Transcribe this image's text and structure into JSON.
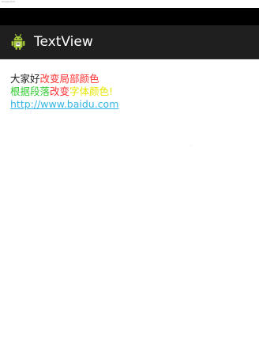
{
  "screenshot_label": "Screenshot",
  "action_bar": {
    "title": "TextView",
    "icon": "android-app-icon"
  },
  "colors": {
    "status_bar": "#000000",
    "action_bar": "#1f1f1f",
    "background": "#ffffff",
    "text_default": "#222222",
    "red": "#ff3333",
    "green": "#33cc33",
    "yellow": "#e6e600",
    "link": "#33b5e5"
  },
  "text_view": {
    "line1": [
      {
        "text": "大家好",
        "color": "#222222"
      },
      {
        "text": "改变局部颜色",
        "color": "#ff3333"
      }
    ],
    "line2": [
      {
        "text": "根据段落",
        "color": "#33cc33"
      },
      {
        "text": "改变",
        "color": "#ff3333"
      },
      {
        "text": "字体颜色!",
        "color": "#e6e600"
      }
    ],
    "link": {
      "text": "http://www.baidu.com",
      "color": "#33b5e5"
    }
  }
}
